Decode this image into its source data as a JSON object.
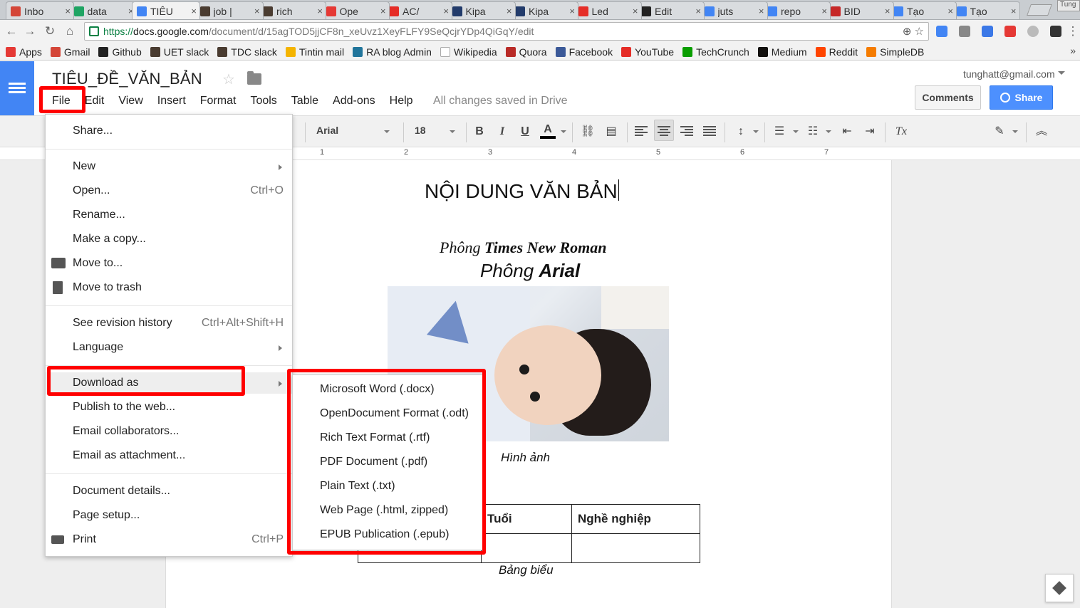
{
  "browser": {
    "tabs": [
      {
        "title": "Inbo",
        "icon": "gmail-icon",
        "color": "#d44638"
      },
      {
        "title": "data",
        "icon": "drive-icon",
        "color": "#1fa463"
      },
      {
        "title": "TIÊU",
        "icon": "docs-icon",
        "color": "#4285f4"
      },
      {
        "title": "job |",
        "icon": "slack-hash-icon",
        "color": "#4a3c31"
      },
      {
        "title": "rich",
        "icon": "slack-hash-icon",
        "color": "#4a3c31"
      },
      {
        "title": "Ope",
        "icon": "pokeball-icon",
        "color": "#e53935"
      },
      {
        "title": "AC/",
        "icon": "youtube-icon",
        "color": "#e52d27"
      },
      {
        "title": "Kipa",
        "icon": "kipalog-icon",
        "color": "#223b6b"
      },
      {
        "title": "Kipa",
        "icon": "kipalog-icon",
        "color": "#223b6b"
      },
      {
        "title": "Led",
        "icon": "youtube-icon",
        "color": "#e52d27"
      },
      {
        "title": "Edit",
        "icon": "github-icon",
        "color": "#222222"
      },
      {
        "title": "juts",
        "icon": "google-icon",
        "color": "#4285f4"
      },
      {
        "title": "repo",
        "icon": "google-icon",
        "color": "#4285f4"
      },
      {
        "title": "BID",
        "icon": "bidv-icon",
        "color": "#c62828"
      },
      {
        "title": "Tạo",
        "icon": "google-icon",
        "color": "#4285f4"
      },
      {
        "title": "Tạo",
        "icon": "google-icon",
        "color": "#4285f4"
      }
    ],
    "tab_close": "×",
    "profile_label": "Tung",
    "url_scheme": "https://",
    "url_host": "docs.google.com",
    "url_path": "/document/d/15agTOD5jjCF8n_xeUvz1XeyFLFY9SeQcjrYDp4QiGqY/edit",
    "bookmarks": [
      {
        "label": "Apps",
        "icon": "apps-grid-icon",
        "color": "#e53935"
      },
      {
        "label": "Gmail",
        "icon": "gmail-icon",
        "color": "#d44638"
      },
      {
        "label": "Github",
        "icon": "github-icon",
        "color": "#222222"
      },
      {
        "label": "UET slack",
        "icon": "slack-hash-icon",
        "color": "#4a3c31"
      },
      {
        "label": "TDC slack",
        "icon": "slack-hash-icon",
        "color": "#4a3c31"
      },
      {
        "label": "Tintin mail",
        "icon": "mail-icon",
        "color": "#f4b400"
      },
      {
        "label": "RA blog Admin",
        "icon": "wordpress-icon",
        "color": "#21759b"
      },
      {
        "label": "Wikipedia",
        "icon": "wikipedia-icon",
        "color": "#ffffff"
      },
      {
        "label": "Quora",
        "icon": "quora-icon",
        "color": "#b92b27"
      },
      {
        "label": "Facebook",
        "icon": "facebook-icon",
        "color": "#3b5998"
      },
      {
        "label": "YouTube",
        "icon": "youtube-icon",
        "color": "#e52d27"
      },
      {
        "label": "TechCrunch",
        "icon": "techcrunch-icon",
        "color": "#0a9e01"
      },
      {
        "label": "Medium",
        "icon": "medium-icon",
        "color": "#12100e"
      },
      {
        "label": "Reddit",
        "icon": "reddit-icon",
        "color": "#ff4500"
      },
      {
        "label": "SimpleDB",
        "icon": "simpledb-icon",
        "color": "#f57c00"
      }
    ],
    "bookmarks_more": "»"
  },
  "docs": {
    "title": "TIÊU_ĐỀ_VĂN_BẢN",
    "menus": [
      "File",
      "Edit",
      "View",
      "Insert",
      "Format",
      "Tools",
      "Table",
      "Add-ons",
      "Help"
    ],
    "saved_status": "All changes saved in Drive",
    "user_email": "tunghatt@gmail.com",
    "comments_label": "Comments",
    "share_label": "Share",
    "accent_color": "#4285f4"
  },
  "toolbar": {
    "font": "Arial",
    "font_size": "18",
    "bold": "B",
    "italic": "I",
    "underline": "U",
    "text_color": "A",
    "clear_format": "Tx"
  },
  "ruler": [
    "1",
    "2",
    "3",
    "4",
    "5",
    "6",
    "7"
  ],
  "document": {
    "heading": "NỘI DUNG VĂN BẢN",
    "times_prefix": "Phông ",
    "times_bold": "Times New Roman",
    "arial_prefix": "Phông ",
    "arial_bold": "Arial",
    "image_caption": "Hình ảnh",
    "table_headers": [
      "",
      "Tuổi",
      "Nghề nghiệp"
    ],
    "table_caption": "Bảng biểu"
  },
  "file_menu": {
    "share": "Share...",
    "new": "New",
    "open": "Open...",
    "open_shortcut": "Ctrl+O",
    "rename": "Rename...",
    "make_copy": "Make a copy...",
    "move_to": "Move to...",
    "move_to_trash": "Move to trash",
    "revision_history": "See revision history",
    "revision_shortcut": "Ctrl+Alt+Shift+H",
    "language": "Language",
    "download_as": "Download as",
    "publish": "Publish to the web...",
    "email_collaborators": "Email collaborators...",
    "email_attachment": "Email as attachment...",
    "document_details": "Document details...",
    "page_setup": "Page setup...",
    "print": "Print",
    "print_shortcut": "Ctrl+P"
  },
  "download_submenu": [
    "Microsoft Word (.docx)",
    "OpenDocument Format (.odt)",
    "Rich Text Format (.rtf)",
    "PDF Document (.pdf)",
    "Plain Text (.txt)",
    "Web Page (.html, zipped)",
    "EPUB Publication (.epub)"
  ],
  "annotation_color": "#ff0000"
}
